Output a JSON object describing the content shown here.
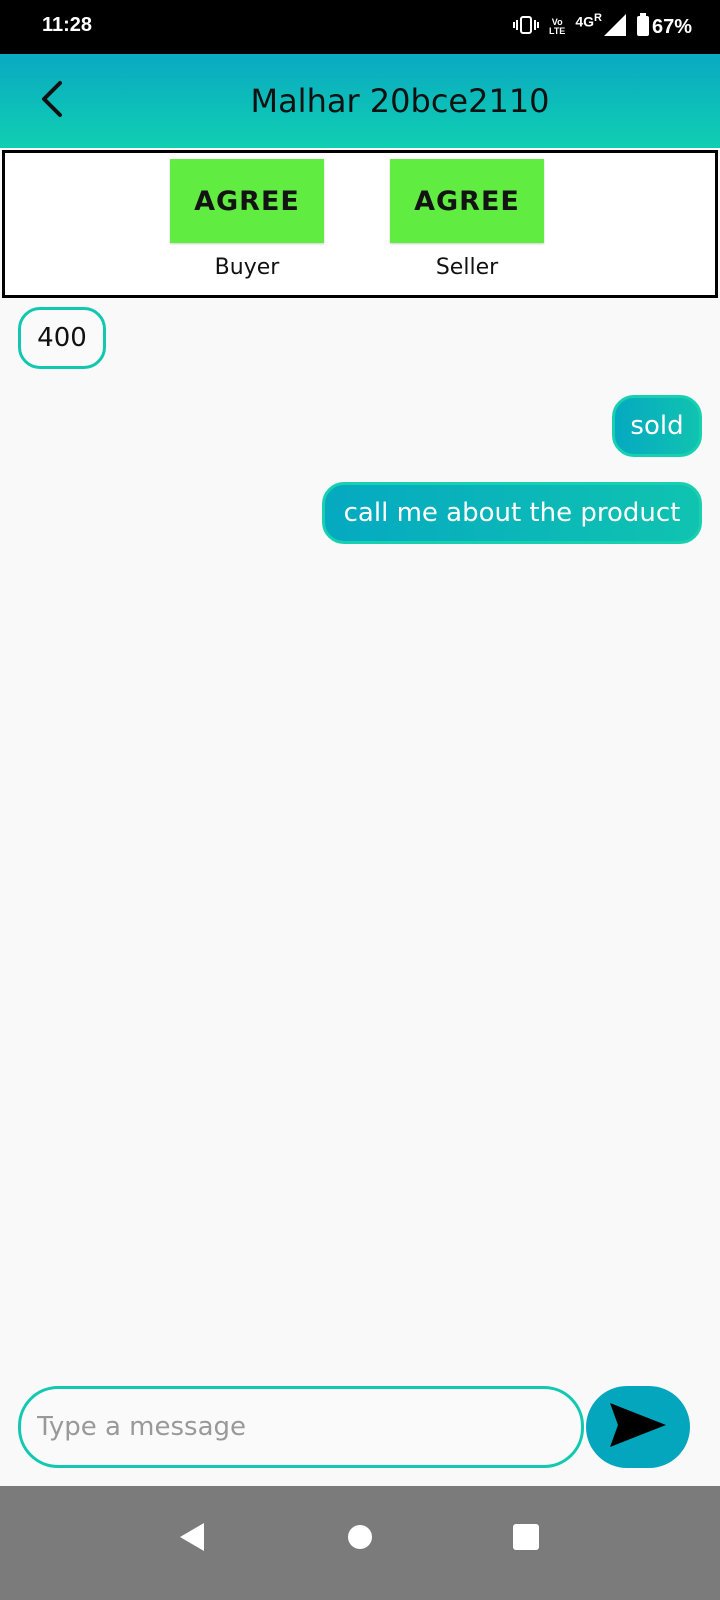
{
  "status_bar": {
    "time": "11:28",
    "volte_top": "Vo",
    "volte_bottom": "LTE",
    "network": "4G",
    "roaming": "R",
    "battery_percent": "67%",
    "icons": [
      "vibrate-icon",
      "volte-icon",
      "signal-icon",
      "battery-icon"
    ]
  },
  "app_bar": {
    "title": "Malhar 20bce2110",
    "back_icon": "back-arrow-icon"
  },
  "agreement": {
    "buyer": {
      "button_label": "AGREE",
      "role": "Buyer"
    },
    "seller": {
      "button_label": "AGREE",
      "role": "Seller"
    },
    "button_color": "#61ec41"
  },
  "messages": [
    {
      "direction": "incoming",
      "text": "400"
    },
    {
      "direction": "outgoing",
      "text": "sold"
    },
    {
      "direction": "outgoing",
      "text": "call me about the product"
    }
  ],
  "composer": {
    "placeholder": "Type a message",
    "value": "",
    "send_icon": "send-icon"
  },
  "nav_bar": {
    "icons": [
      "nav-back-icon",
      "nav-home-icon",
      "nav-recents-icon"
    ]
  },
  "colors": {
    "accent": "#0fc9b0",
    "header_top": "#0aa9c2",
    "send_button": "#03a6bd",
    "agree_green": "#61ec41"
  }
}
